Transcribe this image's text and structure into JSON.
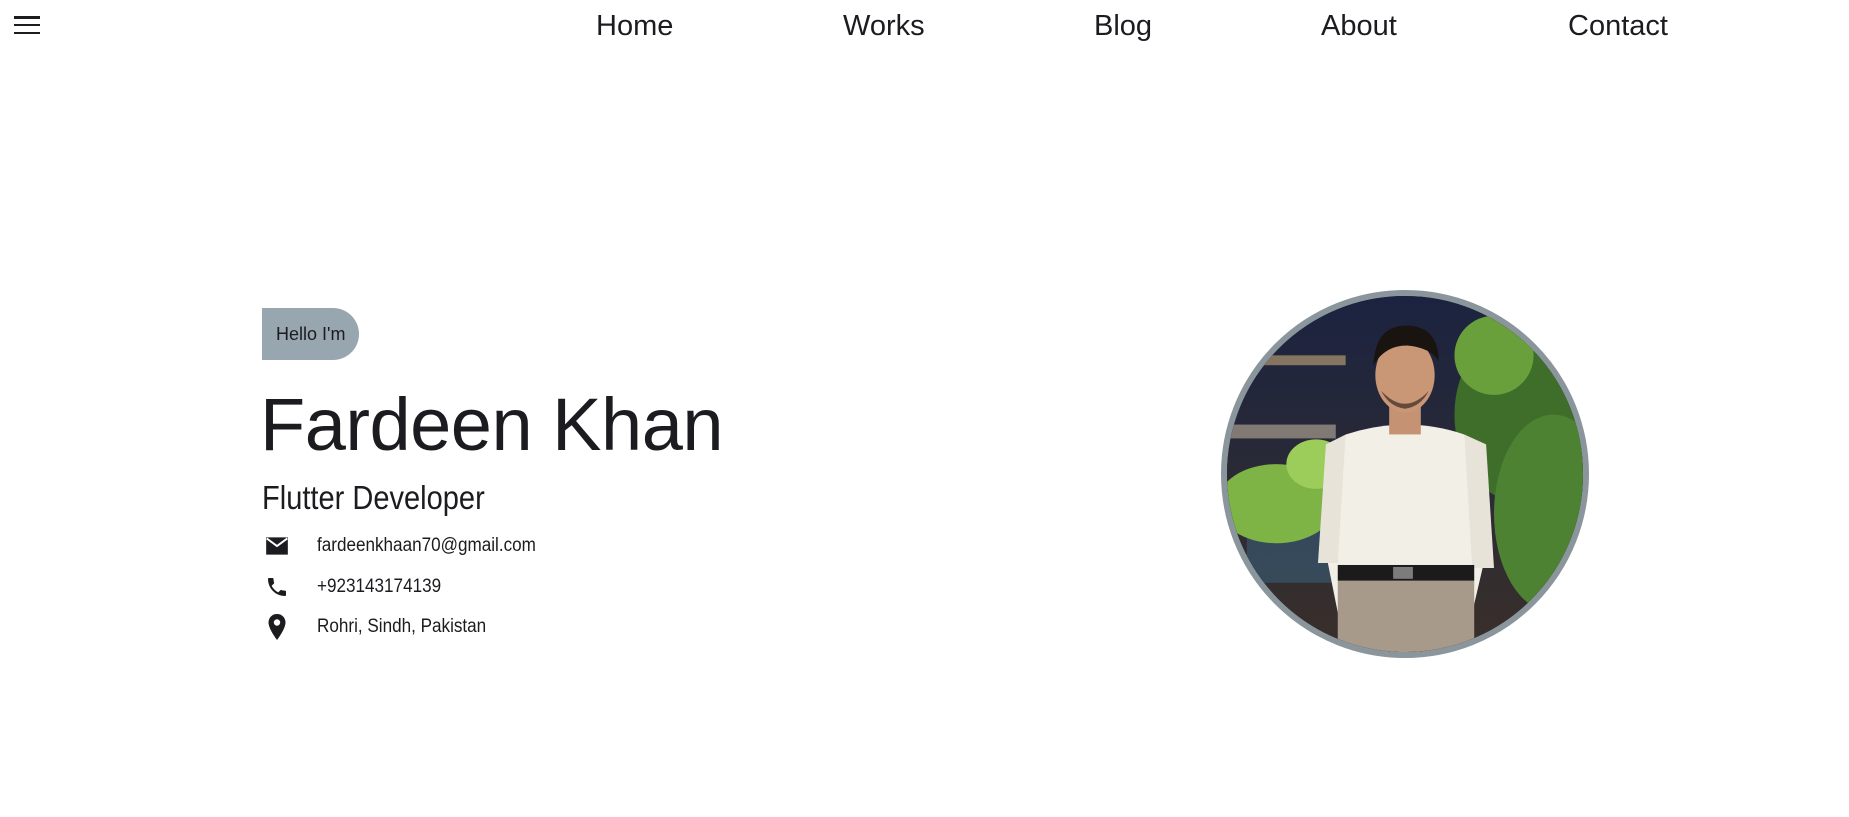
{
  "nav": {
    "menu_icon": "menu-icon",
    "items": [
      {
        "label": "Home"
      },
      {
        "label": "Works"
      },
      {
        "label": "Blog"
      },
      {
        "label": "About"
      },
      {
        "label": "Contact"
      }
    ]
  },
  "hero": {
    "greeting": "Hello I'm",
    "name": "Fardeen Khan",
    "role": "Flutter Developer",
    "contacts": {
      "email": {
        "icon": "mail-icon",
        "value": "fardeenkhaan70@gmail.com"
      },
      "phone": {
        "icon": "phone-icon",
        "value": "+923143174139"
      },
      "location": {
        "icon": "location-pin-icon",
        "value": "Rohri, Sindh, Pakistan"
      }
    },
    "avatar": {
      "icon": "profile-photo"
    }
  },
  "colors": {
    "badge_background": "#98a6b0",
    "avatar_border": "#8a959c",
    "text": "#1c1b1f",
    "background": "#ffffff"
  }
}
